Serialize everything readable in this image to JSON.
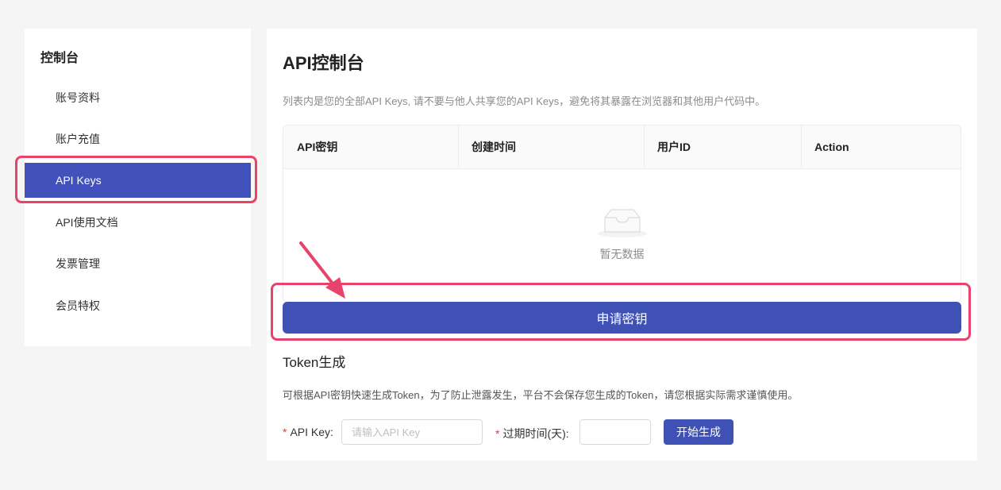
{
  "sidebar": {
    "title": "控制台",
    "items": [
      {
        "label": "账号资料",
        "active": false
      },
      {
        "label": "账户充值",
        "active": false
      },
      {
        "label": "API Keys",
        "active": true
      },
      {
        "label": "API使用文档",
        "active": false
      },
      {
        "label": "发票管理",
        "active": false
      },
      {
        "label": "会员特权",
        "active": false
      }
    ]
  },
  "main": {
    "title": "API控制台",
    "description": "列表内是您的全部API Keys, 请不要与他人共享您的API Keys，避免将其暴露在浏览器和其他用户代码中。",
    "table": {
      "columns": [
        "API密钥",
        "创建时间",
        "用户ID",
        "Action"
      ],
      "empty_text": "暂无数据"
    },
    "apply_button": "申请密钥",
    "token": {
      "title": "Token生成",
      "description": "可根据API密钥快速生成Token，为了防止泄露发生，平台不会保存您生成的Token，请您根据实际需求谨慎使用。",
      "api_key_label": "API Key",
      "api_key_placeholder": "请输入API Key",
      "expire_label": "过期时间(天)",
      "generate_button": "开始生成",
      "required_mark": "*"
    }
  },
  "colors": {
    "accent": "#3f51b5",
    "highlight": "#e8436b"
  }
}
